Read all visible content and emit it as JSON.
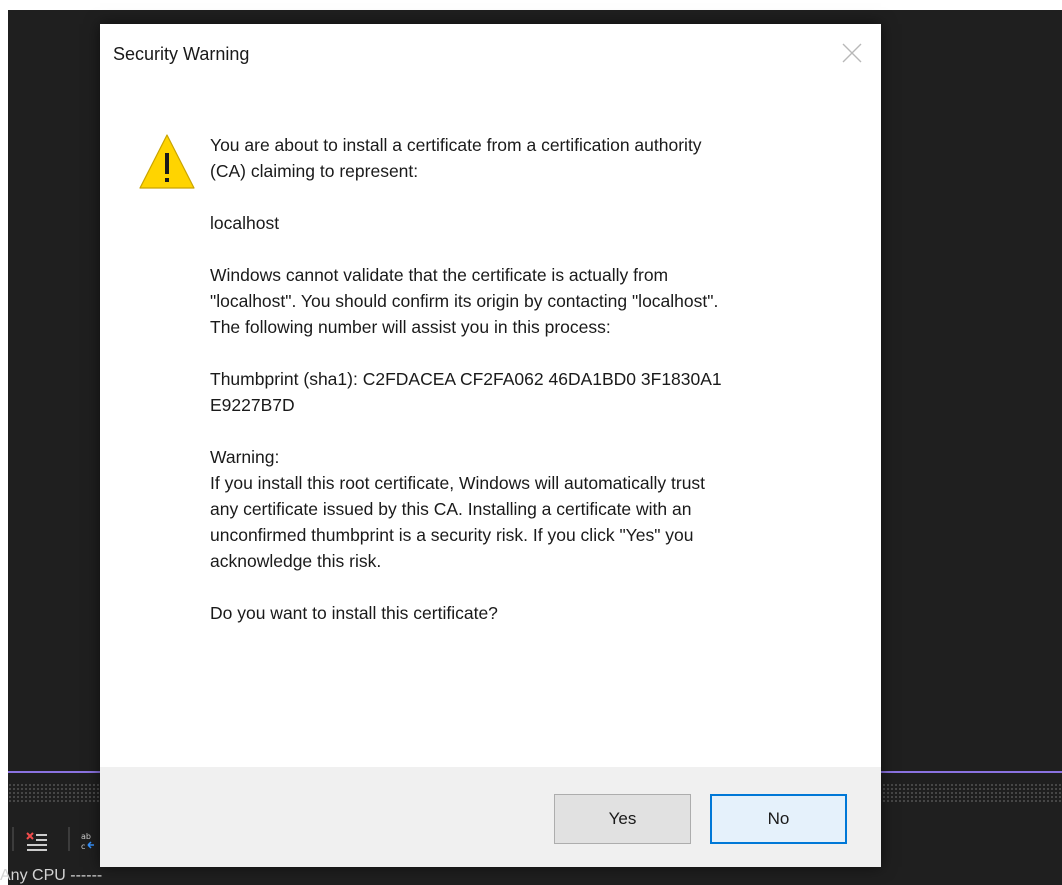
{
  "dialog": {
    "title": "Security Warning",
    "intro": "You are about to install a certificate from a certification authority (CA) claiming to represent:",
    "subject": "localhost",
    "validation_notice": "Windows cannot validate that the certificate is actually from \"localhost\". You should confirm its origin by contacting \"localhost\". The following number will assist you in this process:",
    "thumbprint_label": "Thumbprint (sha1):",
    "thumbprint_value": "C2FDACEA CF2FA062 46DA1BD0 3F1830A1 E9227B7D",
    "warning_heading": "Warning:",
    "warning_text": "If you install this root certificate, Windows will automatically trust any certificate issued by this CA. Installing a certificate with an unconfirmed thumbprint is a security risk. If you click \"Yes\" you acknowledge this risk.",
    "question": "Do you want to install this certificate?",
    "buttons": {
      "yes": "Yes",
      "no": "No"
    },
    "focused_button": "No",
    "icon": "warning-triangle-icon",
    "colors": {
      "warning_fill": "#ffd400",
      "focus_border": "#0078d7"
    }
  },
  "background": {
    "platform_label": "Any CPU",
    "platform_suffix": "------",
    "toolbar_icons": [
      "clear-list-icon",
      "replace-icon"
    ],
    "colors": {
      "ide_background": "#1f1f1f",
      "accent_line": "#8a72e0"
    }
  }
}
